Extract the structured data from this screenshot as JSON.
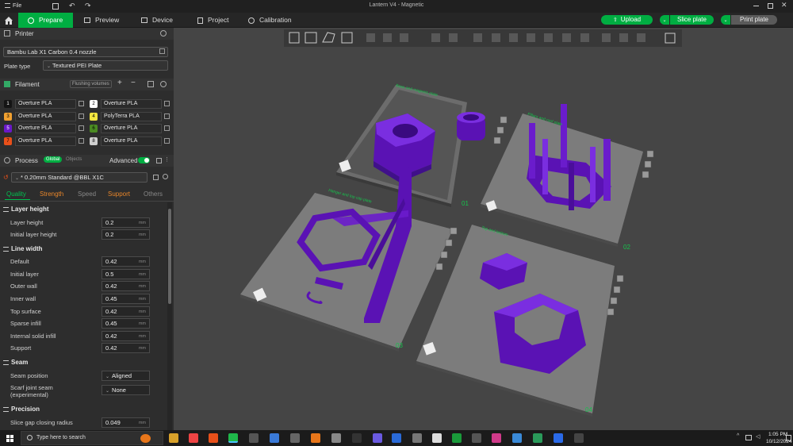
{
  "titlebar": {
    "file_menu": "File",
    "title": "Lantern V4 - Magnetic"
  },
  "topbar": {
    "tabs": [
      {
        "label": "Prepare",
        "active": true
      },
      {
        "label": "Preview"
      },
      {
        "label": "Device"
      },
      {
        "label": "Project"
      },
      {
        "label": "Calibration"
      }
    ],
    "upload": "Upload",
    "slice_plate": "Slice plate",
    "print_plate": "Print plate"
  },
  "printer": {
    "section": "Printer",
    "model": "Bambu Lab X1 Carbon 0.4 nozzle",
    "plate_type_label": "Plate type",
    "plate_type": "Textured PEI Plate"
  },
  "filament": {
    "section": "Filament",
    "flushing": "Flushing volumes",
    "items": [
      {
        "num": "1",
        "name": "Overture PLA",
        "color": "#141414"
      },
      {
        "num": "2",
        "name": "Overture PLA",
        "color": "#ffffff"
      },
      {
        "num": "3",
        "name": "Overture PLA",
        "color": "#f0a030"
      },
      {
        "num": "4",
        "name": "PolyTerra PLA",
        "color": "#f2e640"
      },
      {
        "num": "5",
        "name": "Overture PLA",
        "color": "#6a18c8"
      },
      {
        "num": "6",
        "name": "Overture PLA",
        "color": "#4a8a22"
      },
      {
        "num": "7",
        "name": "Overture PLA",
        "color": "#e8501a"
      },
      {
        "num": "8",
        "name": "Overture PLA",
        "color": "#cfcfcf"
      }
    ]
  },
  "process": {
    "section": "Process",
    "global": "Global",
    "objects": "Objects",
    "advanced": "Advanced",
    "preset": "* 0.20mm Standard @BBL X1C",
    "tabs": [
      "Quality",
      "Strength",
      "Speed",
      "Support",
      "Others"
    ],
    "groups": [
      {
        "title": "Layer height",
        "rows": [
          {
            "label": "Layer height",
            "value": "0.2",
            "unit": "mm"
          },
          {
            "label": "Initial layer height",
            "value": "0.2",
            "unit": "mm"
          }
        ]
      },
      {
        "title": "Line width",
        "rows": [
          {
            "label": "Default",
            "value": "0.42",
            "unit": "mm"
          },
          {
            "label": "Initial layer",
            "value": "0.5",
            "unit": "mm"
          },
          {
            "label": "Outer wall",
            "value": "0.42",
            "unit": "mm"
          },
          {
            "label": "Inner wall",
            "value": "0.45",
            "unit": "mm"
          },
          {
            "label": "Top surface",
            "value": "0.42",
            "unit": "mm"
          },
          {
            "label": "Sparse infill",
            "value": "0.45",
            "unit": "mm"
          },
          {
            "label": "Internal solid infill",
            "value": "0.42",
            "unit": "mm"
          },
          {
            "label": "Support",
            "value": "0.42",
            "unit": "mm"
          }
        ]
      },
      {
        "title": "Seam",
        "rows": [
          {
            "label": "Seam position",
            "value": "Aligned"
          },
          {
            "label": "Scarf joint seam",
            "label2": "(experimental)",
            "value": "None"
          }
        ]
      },
      {
        "title": "Precision",
        "rows": [
          {
            "label": "Slice gap closing radius",
            "value": "0.049",
            "unit": "mm"
          }
        ]
      }
    ]
  },
  "viewport": {
    "plate_labels": [
      "01",
      "02",
      "03",
      "04"
    ],
    "plate_captions": [
      "Base and magnets plate",
      "Pillars and roof plate",
      "Hanger and top cap plate",
      "Top and bottom"
    ]
  },
  "taskbar": {
    "search_placeholder": "Type here to search",
    "time": "1:05 PM",
    "date": "10/12/2024"
  },
  "colors": {
    "accent": "#00ae42",
    "model": "#5a12b4"
  }
}
